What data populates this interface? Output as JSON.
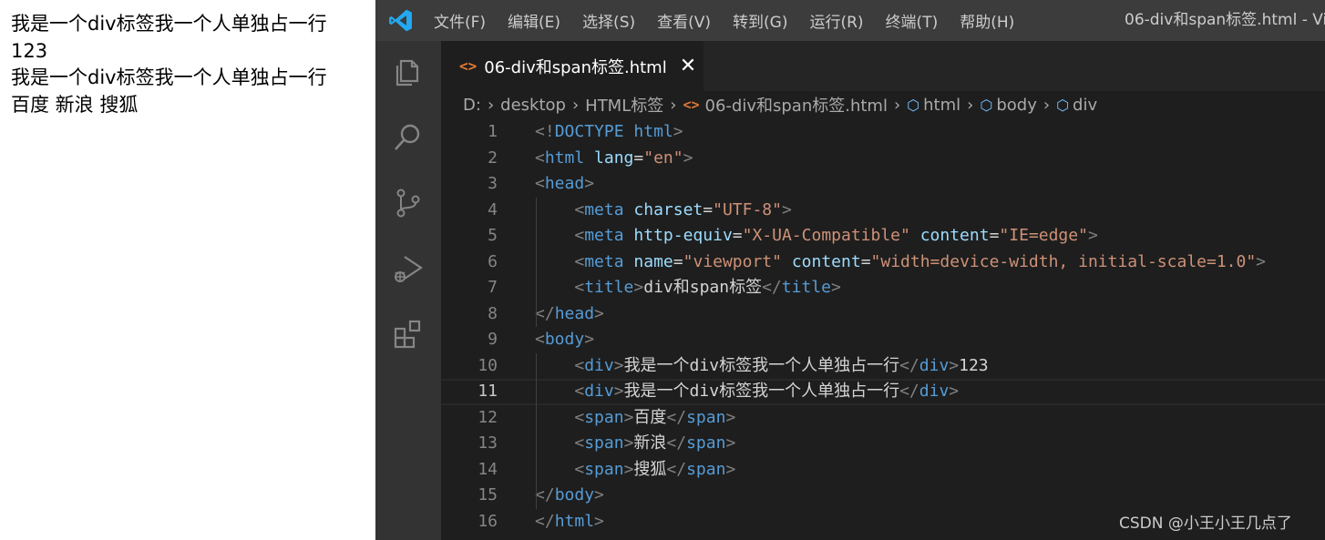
{
  "preview": {
    "lines": [
      "我是一个div标签我一个人单独占一行",
      "123",
      "我是一个div标签我一个人单独占一行",
      "百度 新浪 搜狐"
    ]
  },
  "menu": [
    "文件(F)",
    "编辑(E)",
    "选择(S)",
    "查看(V)",
    "转到(G)",
    "运行(R)",
    "终端(T)",
    "帮助(H)"
  ],
  "window_title": "06-div和span标签.html - Vis",
  "activity_icons": [
    "explorer-icon",
    "search-icon",
    "source-control-icon",
    "run-debug-icon",
    "extensions-icon"
  ],
  "tab": {
    "icon": "<>",
    "label": "06-div和span标签.html",
    "close": "✕"
  },
  "breadcrumb": [
    "D:",
    "desktop",
    "HTML标签",
    "06-div和span标签.html",
    "html",
    "body",
    "div"
  ],
  "editor": {
    "current_line": 11,
    "lines": [
      {
        "n": "1",
        "text": "<!DOCTYPE html>"
      },
      {
        "n": "2",
        "text": "<html lang=\"en\">"
      },
      {
        "n": "3",
        "text": "<head>"
      },
      {
        "n": "4",
        "text": "    <meta charset=\"UTF-8\">"
      },
      {
        "n": "5",
        "text": "    <meta http-equiv=\"X-UA-Compatible\" content=\"IE=edge\">"
      },
      {
        "n": "6",
        "text": "    <meta name=\"viewport\" content=\"width=device-width, initial-scale=1.0\">"
      },
      {
        "n": "7",
        "text": "    <title>div和span标签</title>"
      },
      {
        "n": "8",
        "text": "</head>"
      },
      {
        "n": "9",
        "text": "<body>"
      },
      {
        "n": "10",
        "text": "    <div>我是一个div标签我一个人单独占一行</div>123"
      },
      {
        "n": "11",
        "text": "    <div>我是一个div标签我一个人单独占一行</div>"
      },
      {
        "n": "12",
        "text": "    <span>百度</span>"
      },
      {
        "n": "13",
        "text": "    <span>新浪</span>"
      },
      {
        "n": "14",
        "text": "    <span>搜狐</span>"
      },
      {
        "n": "15",
        "text": "</body>"
      },
      {
        "n": "16",
        "text": "</html>"
      }
    ]
  },
  "watermark": "CSDN @小王小王几点了",
  "colors": {
    "tag": "#569cd6",
    "attr": "#9cdcfe",
    "string": "#ce9178",
    "bracket": "#808080",
    "text": "#d4d4d4",
    "html_icon": "#e37933",
    "symbol_icon": "#75beff"
  }
}
